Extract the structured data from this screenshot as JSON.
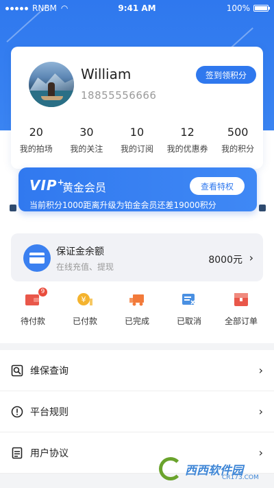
{
  "status_bar": {
    "carrier": "RNBM",
    "time": "9:41 AM",
    "battery": "100%"
  },
  "profile": {
    "name": "William",
    "phone": "18855556666",
    "checkin_button": "签到领积分"
  },
  "stats": [
    {
      "value": "20",
      "label": "我的拍场"
    },
    {
      "value": "30",
      "label": "我的关注"
    },
    {
      "value": "10",
      "label": "我的订阅"
    },
    {
      "value": "12",
      "label": "我的优惠券"
    },
    {
      "value": "500",
      "label": "我的积分"
    }
  ],
  "vip": {
    "logo": "VIP",
    "title": "黄金会员",
    "privilege_button": "查看特权",
    "description": "当前积分1000距离升级为铂金会员还差19000积分"
  },
  "deposit": {
    "title": "保证金余额",
    "subtitle": "在线充值、提现",
    "amount": "8000元"
  },
  "orders": [
    {
      "label": "待付款",
      "badge": "9",
      "icon": "wallet-icon"
    },
    {
      "label": "已付款",
      "icon": "yen-coin-icon"
    },
    {
      "label": "已完成",
      "icon": "truck-icon"
    },
    {
      "label": "已取消",
      "icon": "cancel-order-icon"
    },
    {
      "label": "全部订单",
      "icon": "all-orders-icon"
    }
  ],
  "menu": [
    {
      "label": "维保查询",
      "icon": "search-icon"
    },
    {
      "label": "平台规则",
      "icon": "info-icon"
    },
    {
      "label": "用户协议",
      "icon": "document-icon"
    }
  ],
  "watermark": {
    "text": "西西软件园",
    "sub": "CR173.COM"
  },
  "colors": {
    "primary": "#2f78ee",
    "badge": "#e94c3c"
  }
}
